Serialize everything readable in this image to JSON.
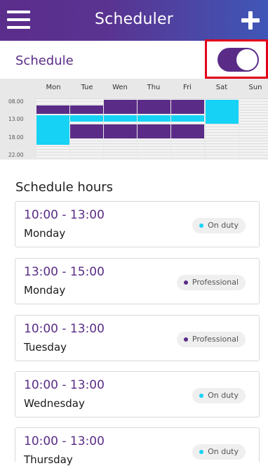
{
  "header": {
    "title": "Scheduler",
    "menu_icon": "hamburger-icon",
    "add_icon": "plus-icon"
  },
  "schedule": {
    "label": "Schedule",
    "toggle_on": true,
    "toggle_color": "#5a2c87"
  },
  "calendar": {
    "days": [
      "Mon",
      "Tue",
      "Wen",
      "Thu",
      "Fri",
      "Sat",
      "Sun"
    ],
    "times": [
      "08.00",
      "13.00",
      "18.00",
      "22.00"
    ],
    "colors": {
      "professional": "#5a2c87",
      "on_duty": "#16d2f5"
    }
  },
  "schedule_hours": {
    "title": "Schedule hours",
    "items": [
      {
        "time": "10:00 - 13:00",
        "day": "Monday",
        "status": "On duty",
        "dot_color": "#16d2f5"
      },
      {
        "time": "13:00 - 15:00",
        "day": "Monday",
        "status": "Professional",
        "dot_color": "#5a2c87"
      },
      {
        "time": "10:00 - 13:00",
        "day": "Tuesday",
        "status": "Professional",
        "dot_color": "#5a2c87"
      },
      {
        "time": "10:00 - 13:00",
        "day": "Wednesday",
        "status": "On duty",
        "dot_color": "#16d2f5"
      },
      {
        "time": "10:00 - 13:00",
        "day": "Thursday",
        "status": "On duty",
        "dot_color": "#16d2f5"
      }
    ]
  }
}
